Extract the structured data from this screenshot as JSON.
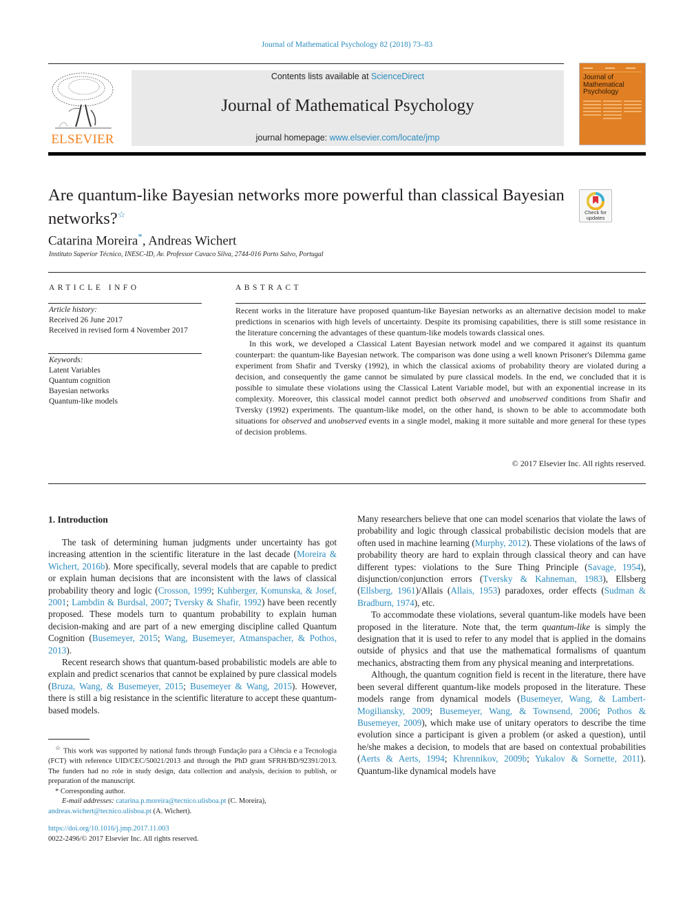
{
  "header": {
    "running_head": "Journal of Mathematical Psychology 82 (2018) 73–83",
    "publisher": "ELSEVIER",
    "contents_prefix": "Contents lists available at ",
    "contents_link": "ScienceDirect",
    "journal_title": "Journal of Mathematical Psychology",
    "homepage_prefix": "journal homepage: ",
    "homepage_link": "www.elsevier.com/locate/jmp",
    "cover_title": "Journal of Mathematical Psychology",
    "crossmark_label": "Check for updates"
  },
  "article": {
    "title": "Are quantum-like Bayesian networks more powerful than classical Bayesian networks?",
    "title_footnote_marker": "☆",
    "authors": [
      {
        "name": "Catarina Moreira",
        "marker": "*"
      },
      {
        "name": "Andreas Wichert",
        "marker": ""
      }
    ],
    "affiliation": "Instituto Superior Técnico, INESC-ID, Av. Professor Cavaco Silva, 2744-016 Porto Salvo, Portugal"
  },
  "article_info": {
    "label": "ARTICLE INFO",
    "history_heading": "Article history:",
    "received": "Received 26 June 2017",
    "revised": "Received in revised form 4 November 2017",
    "keywords_heading": "Keywords:",
    "keywords": [
      "Latent Variables",
      "Quantum cognition",
      "Bayesian networks",
      "Quantum-like models"
    ]
  },
  "abstract": {
    "label": "ABSTRACT",
    "p1": "Recent works in the literature have proposed quantum-like Bayesian networks as an alternative decision model to make predictions in scenarios with high levels of uncertainty. Despite its promising capabilities, there is still some resistance in the literature concerning the advantages of these quantum-like models towards classical ones.",
    "p2_a": "In this work, we developed a Classical Latent Bayesian network model and we compared it against its quantum counterpart: the quantum-like Bayesian network. The comparison was done using a well known Prisoner's Dilemma game experiment from Shafir and Tversky (1992), in which the classical axioms of probability theory are violated during a decision, and consequently the game cannot be simulated by pure classical models. In the end, we concluded that it is possible to simulate these violations using the Classical Latent Variable model, but with an exponential increase in its complexity. Moreover, this classical model cannot predict both ",
    "p2_em1": "observed",
    "p2_b": " and ",
    "p2_em2": "unobserved",
    "p2_c": " conditions from Shafir and Tversky (1992) experiments. The quantum-like model, on the other hand, is shown to be able to accommodate both situations for ",
    "p2_em3": "observed",
    "p2_d": " and ",
    "p2_em4": "unobserved",
    "p2_e": " events in a single model, making it more suitable and more general for these types of decision problems.",
    "copyright": "© 2017 Elsevier Inc. All rights reserved."
  },
  "intro": {
    "heading": "1.  Introduction",
    "left_p1": [
      {
        "t": "The task of determining human judgments under uncertainty has got increasing attention in the scientific literature in the last decade ("
      },
      {
        "l": "Moreira & Wichert, 2016b"
      },
      {
        "t": "). More specifically, several models that are capable to predict or explain human decisions that are inconsistent with the laws of classical probability theory and logic ("
      },
      {
        "l": "Crosson, 1999"
      },
      {
        "t": "; "
      },
      {
        "l": "Kuhberger, Komunska, & Josef, 2001"
      },
      {
        "t": "; "
      },
      {
        "l": "Lambdin & Burdsal, 2007"
      },
      {
        "t": "; "
      },
      {
        "l": "Tversky & Shafir, 1992"
      },
      {
        "t": ") have been recently proposed. These models turn to quantum probability to explain human decision-making and are part of a new emerging discipline called Quantum Cognition ("
      },
      {
        "l": "Busemeyer, 2015"
      },
      {
        "t": "; "
      },
      {
        "l": "Wang, Busemeyer, Atmanspacher, & Pothos, 2013"
      },
      {
        "t": ")."
      }
    ],
    "left_p2": [
      {
        "t": "Recent research shows that quantum-based probabilistic models are able to explain and predict scenarios that cannot be explained by pure classical models ("
      },
      {
        "l": "Bruza, Wang, & Busemeyer, 2015"
      },
      {
        "t": "; "
      },
      {
        "l": "Busemeyer & Wang, 2015"
      },
      {
        "t": "). However, there is still a big resistance in the scientific literature to accept these quantum-based models."
      }
    ],
    "right_p1": [
      {
        "t": "Many researchers believe that one can model scenarios that violate the laws of probability and logic through classical probabilistic decision models that are often used in machine learning ("
      },
      {
        "l": "Murphy, 2012"
      },
      {
        "t": "). These violations of the laws of probability theory are hard to explain through classical theory and can have different types: violations to the Sure Thing Principle ("
      },
      {
        "l": "Savage, 1954"
      },
      {
        "t": "), disjunction/conjunction errors ("
      },
      {
        "l": "Tversky & Kahneman, 1983"
      },
      {
        "t": "), Ellsberg ("
      },
      {
        "l": "Ellsberg, 1961"
      },
      {
        "t": ")/Allais ("
      },
      {
        "l": "Allais, 1953"
      },
      {
        "t": ") paradoxes, order effects ("
      },
      {
        "l": "Sudman & Bradburn, 1974"
      },
      {
        "t": "), etc."
      }
    ],
    "right_p2": [
      {
        "t": "To accommodate these violations, several quantum-like models have been proposed in the literature. Note that, the term "
      },
      {
        "e": "quantum-like"
      },
      {
        "t": " is simply the designation that it is used to refer to any model that is applied in the domains outside of physics and that use the mathematical formalisms of quantum mechanics, abstracting them from any physical meaning and interpretations."
      }
    ],
    "right_p3": [
      {
        "t": "Although, the quantum cognition field is recent in the literature, there have been several different quantum-like models proposed in the literature. These models range from dynamical models ("
      },
      {
        "l": "Busemeyer, Wang, & Lambert-Mogiliansky, 2009"
      },
      {
        "t": "; "
      },
      {
        "l": "Busemeyer, Wang, & Townsend, 2006"
      },
      {
        "t": "; "
      },
      {
        "l": "Pothos & Busemeyer, 2009"
      },
      {
        "t": "), which make use of unitary operators to describe the time evolution since a participant is given a problem (or asked a question), until he/she makes a decision, to models that are based on contextual probabilities ("
      },
      {
        "l": "Aerts & Aerts, 1994"
      },
      {
        "t": "; "
      },
      {
        "l": "Khrennikov, 2009b"
      },
      {
        "t": "; "
      },
      {
        "l": "Yukalov & Sornette, 2011"
      },
      {
        "t": "). Quantum-like dynamical models have"
      }
    ]
  },
  "footnotes": {
    "funding_marker": "☆",
    "funding": "This work was supported by national funds through Fundação para a Ciência e a Tecnologia (FCT) with reference UID/CEC/50021/2013 and through the PhD grant SFRH/BD/92391/2013. The funders had no role in study design, data collection and analysis, decision to publish, or preparation of the manuscript.",
    "corresponding_marker": "*",
    "corresponding": "Corresponding author.",
    "email_label": "E-mail addresses:",
    "email_1": "catarina.p.moreira@tecnico.ulisboa.pt",
    "email_1_owner": " (C. Moreira),",
    "email_2": "andreas.wichert@tecnico.ulisboa.pt",
    "email_2_owner": " (A. Wichert).",
    "doi": "https://doi.org/10.1016/j.jmp.2017.11.003",
    "issn_copyright": "0022-2496/© 2017 Elsevier Inc. All rights reserved."
  },
  "colors": {
    "link": "#2a8bbf",
    "elsevier_orange": "#f58220",
    "banner_gray": "#e9e9e9",
    "cover_orange": "#e07f23"
  }
}
